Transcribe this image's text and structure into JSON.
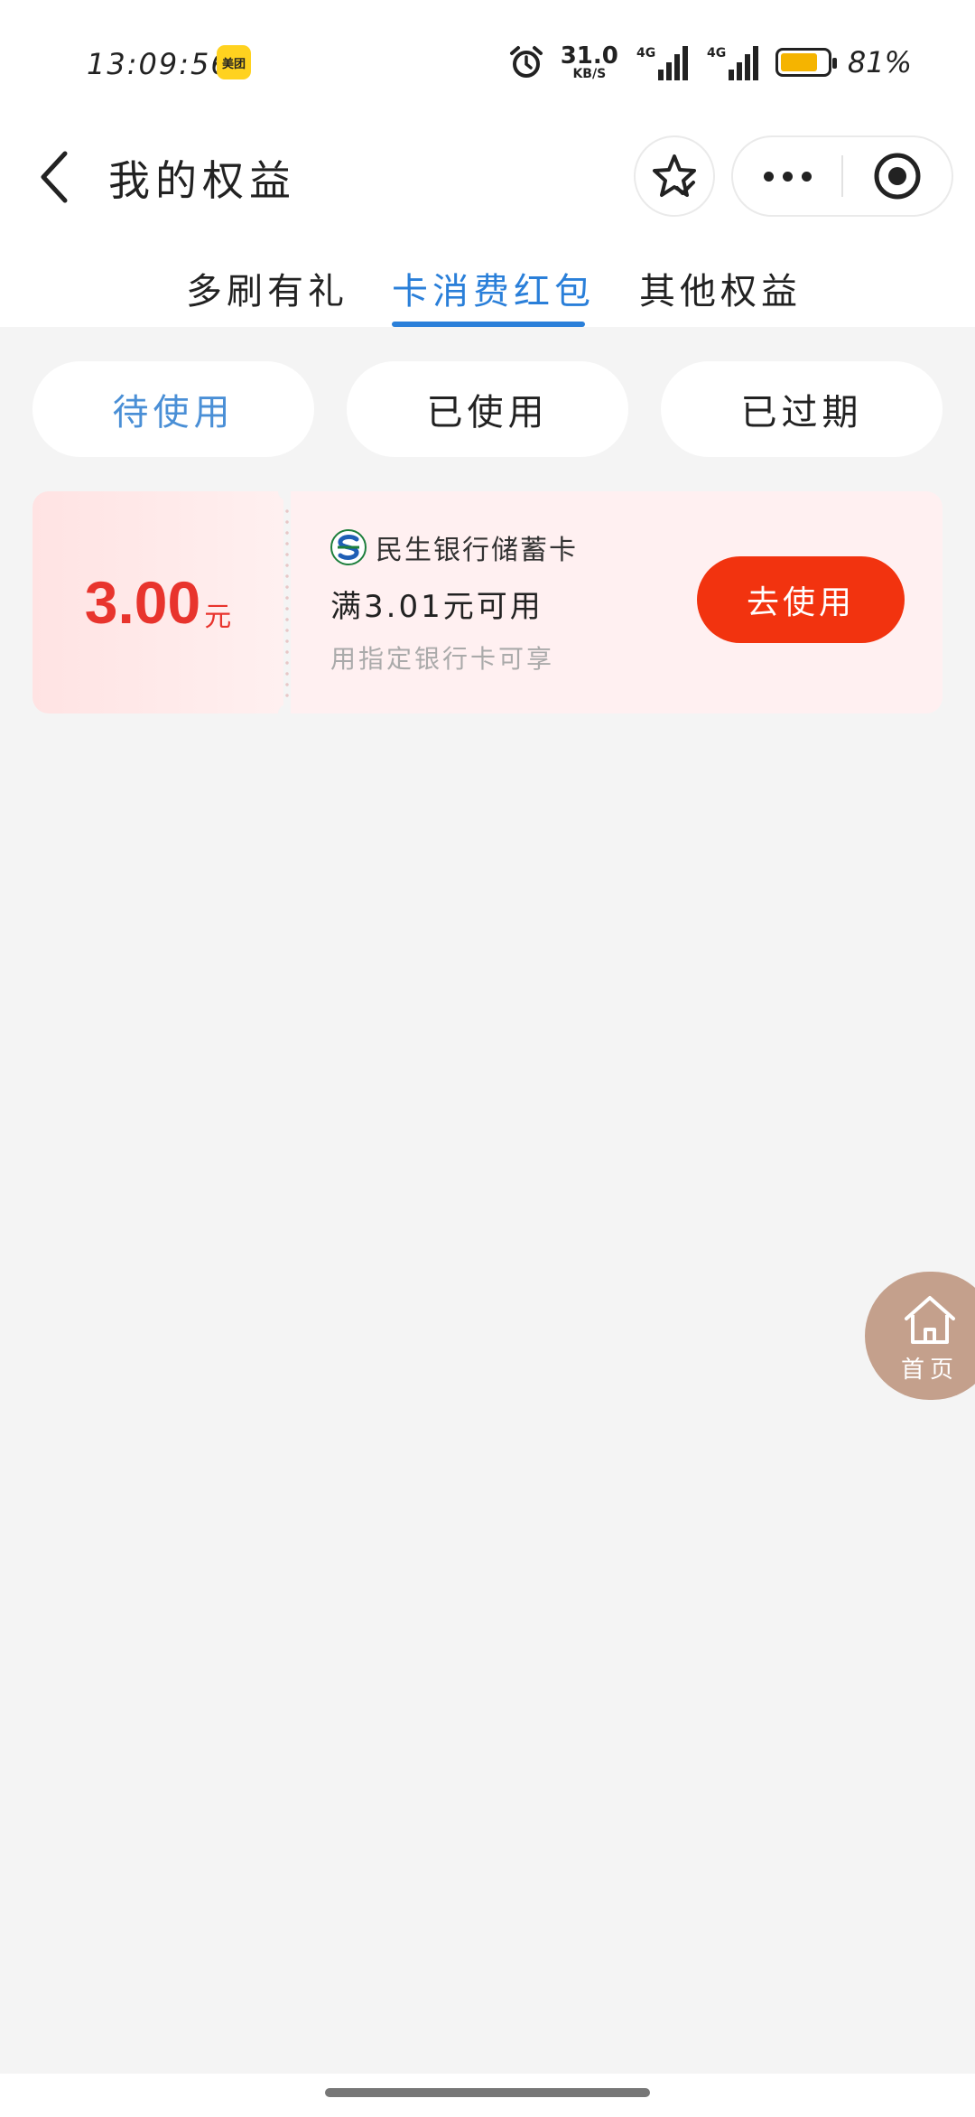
{
  "status_bar": {
    "time": "13:09:56",
    "app_badge": "美团",
    "net_speed": "31.0",
    "net_unit": "KB/S",
    "battery_pct": "81%",
    "battery_level": 0.81
  },
  "header": {
    "title": "我的权益"
  },
  "tabs": [
    {
      "label": "多刷有礼",
      "active": false
    },
    {
      "label": "卡消费红包",
      "active": true
    },
    {
      "label": "其他权益",
      "active": false
    }
  ],
  "filters": [
    {
      "label": "待使用",
      "active": true
    },
    {
      "label": "已使用",
      "active": false
    },
    {
      "label": "已过期",
      "active": false
    }
  ],
  "coupon": {
    "amount": "3.00",
    "unit": "元",
    "bank_name": "民生银行储蓄卡",
    "condition": "满3.01元可用",
    "note": "用指定银行卡可享",
    "button_label": "去使用"
  },
  "home_fab": {
    "label": "首页"
  },
  "colors": {
    "accent_blue": "#2a7fd9",
    "coupon_red": "#e8342d",
    "button_red": "#f2330f",
    "fab_brown": "#c4a08c"
  },
  "icons": {
    "back": "chevron-left-icon",
    "favorite": "star-icon",
    "more": "more-dots-icon",
    "close": "target-circle-icon",
    "home": "home-icon"
  }
}
